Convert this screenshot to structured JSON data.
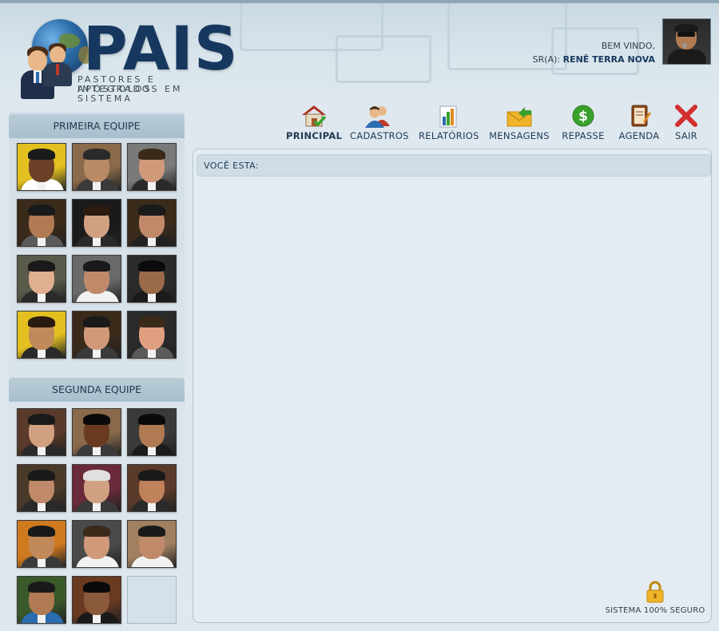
{
  "logo": {
    "title": "PAIS",
    "subtitle_line1": "PASTORES E APÓSTOLOS",
    "subtitle_line2": "INTEGRADOS EM SISTEMA"
  },
  "welcome": {
    "greeting": "BEM VINDO,",
    "prefix": "SR(A):",
    "user_name": "RENÊ TERRA NOVA"
  },
  "menu": [
    {
      "label": "PRINCIPAL",
      "icon": "home-icon",
      "active": true
    },
    {
      "label": "CADASTROS",
      "icon": "users-icon"
    },
    {
      "label": "RELATÓRIOS",
      "icon": "report-icon"
    },
    {
      "label": "MENSAGENS",
      "icon": "mail-icon"
    },
    {
      "label": "REPASSE",
      "icon": "dollar-icon"
    },
    {
      "label": "AGENDA",
      "icon": "agenda-icon"
    },
    {
      "label": "SAIR",
      "icon": "exit-icon"
    }
  ],
  "sidebar": {
    "team1_title": "PRIMEIRA EQUIPE",
    "team2_title": "SEGUNDA EQUIPE"
  },
  "breadcrumb": {
    "label": "VOCÊ ESTA:"
  },
  "footer": {
    "secure_text": "SISTEMA 100% SEGURO"
  },
  "colors": {
    "brand": "#17385e",
    "background": "#dfe8ee",
    "panel": "#e5ecf1",
    "exit_red": "#d32f2f",
    "dollar_green": "#3aa02c"
  }
}
